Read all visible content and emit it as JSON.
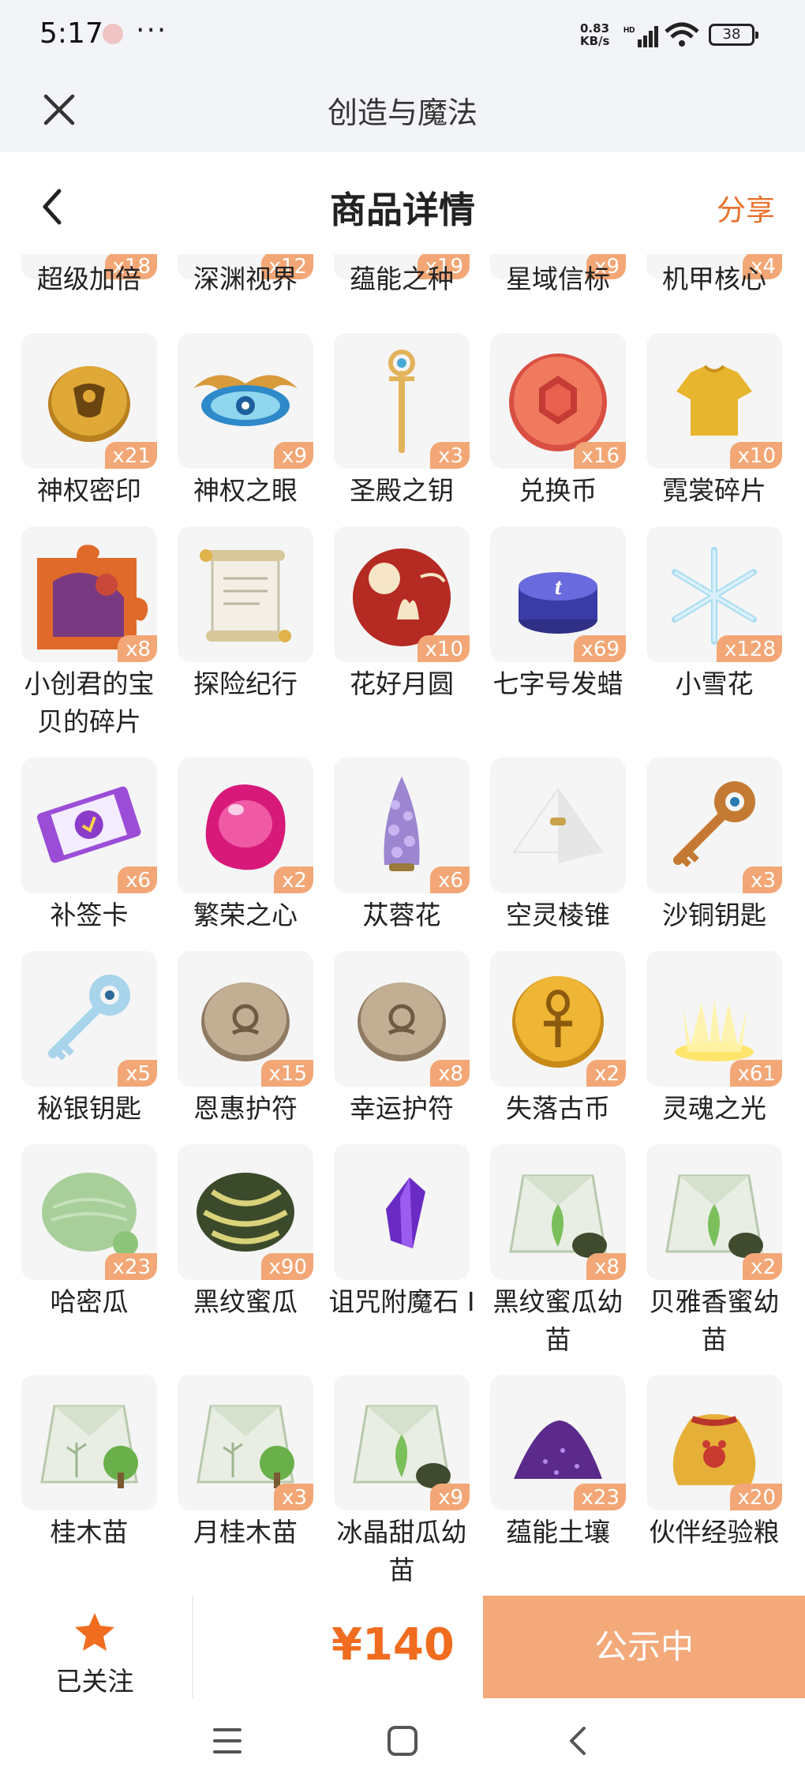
{
  "status_bar": {
    "time": "5:17",
    "dots": "···",
    "speed_value": "0.83",
    "speed_unit": "KB/s",
    "network": "HD",
    "battery": "38"
  },
  "app_bar": {
    "title": "创造与魔法",
    "close_icon": "close-icon"
  },
  "header": {
    "title": "商品详情",
    "share_label": "分享",
    "back_icon": "chevron-left-icon"
  },
  "partial_row": [
    {
      "name": "超级加倍",
      "qty": "x18"
    },
    {
      "name": "深渊视界",
      "qty": "x12"
    },
    {
      "name": "蕴能之种",
      "qty": "x19"
    },
    {
      "name": "星域信标",
      "qty": "x9"
    },
    {
      "name": "机甲核心",
      "qty": "x4"
    }
  ],
  "items": [
    {
      "name": "神权密印",
      "qty": "x21",
      "icon": "golden-seal-icon"
    },
    {
      "name": "神权之眼",
      "qty": "x9",
      "icon": "winged-eye-icon"
    },
    {
      "name": "圣殿之钥",
      "qty": "x3",
      "icon": "golden-staff-icon"
    },
    {
      "name": "兑换币",
      "qty": "x16",
      "icon": "red-gem-coin-icon"
    },
    {
      "name": "霓裳碎片",
      "qty": "x10",
      "icon": "gold-shirt-icon"
    },
    {
      "name": "小创君的宝贝的碎片",
      "qty": "x8",
      "icon": "puzzle-piece-icon"
    },
    {
      "name": "探险纪行",
      "qty": "",
      "icon": "scroll-icon"
    },
    {
      "name": "花好月圆",
      "qty": "x10",
      "icon": "moon-rabbit-icon"
    },
    {
      "name": "七字号发蜡",
      "qty": "x69",
      "icon": "hair-wax-icon"
    },
    {
      "name": "小雪花",
      "qty": "x128",
      "icon": "snowflake-icon"
    },
    {
      "name": "补签卡",
      "qty": "x6",
      "icon": "ticket-card-icon"
    },
    {
      "name": "繁荣之心",
      "qty": "x2",
      "icon": "pink-gem-icon"
    },
    {
      "name": "苁蓉花",
      "qty": "x6",
      "icon": "purple-flower-icon"
    },
    {
      "name": "空灵棱锥",
      "qty": "",
      "icon": "pyramid-icon"
    },
    {
      "name": "沙铜钥匙",
      "qty": "x3",
      "icon": "bronze-key-icon"
    },
    {
      "name": "秘银钥匙",
      "qty": "x5",
      "icon": "silver-key-icon"
    },
    {
      "name": "恩惠护符",
      "qty": "x15",
      "icon": "stone-amulet-icon"
    },
    {
      "name": "幸运护符",
      "qty": "x8",
      "icon": "stone-amulet-icon"
    },
    {
      "name": "失落古币",
      "qty": "x2",
      "icon": "ankh-coin-icon"
    },
    {
      "name": "灵魂之光",
      "qty": "x61",
      "icon": "soul-light-icon"
    },
    {
      "name": "哈密瓜",
      "qty": "x23",
      "icon": "melon-icon"
    },
    {
      "name": "黑纹蜜瓜",
      "qty": "x90",
      "icon": "striped-melon-icon"
    },
    {
      "name": "诅咒附魔石 I",
      "qty": "",
      "icon": "purple-crystal-icon"
    },
    {
      "name": "黑纹蜜瓜幼苗",
      "qty": "x8",
      "icon": "seed-packet-icon"
    },
    {
      "name": "贝雅香蜜幼苗",
      "qty": "x2",
      "icon": "seed-packet-icon"
    },
    {
      "name": "桂木苗",
      "qty": "",
      "icon": "tree-seed-packet-icon"
    },
    {
      "name": "月桂木苗",
      "qty": "x3",
      "icon": "tree-seed-packet-icon"
    },
    {
      "name": "冰晶甜瓜幼苗",
      "qty": "x9",
      "icon": "seed-packet-icon"
    },
    {
      "name": "蕴能土壤",
      "qty": "x23",
      "icon": "purple-soil-icon"
    },
    {
      "name": "伙伴经验粮",
      "qty": "x20",
      "icon": "treat-bag-icon"
    }
  ],
  "bottom": {
    "follow_label": "已关注",
    "price": "¥140",
    "action_label": "公示中"
  },
  "nav": {
    "menu_icon": "menu-icon",
    "home_icon": "home-square-icon",
    "back_icon": "back-arrow-icon"
  },
  "colors": {
    "accent": "#e8732e",
    "price": "#f06c1f",
    "action_bg": "#f4a97a",
    "qty_bg": "#f3a776"
  }
}
